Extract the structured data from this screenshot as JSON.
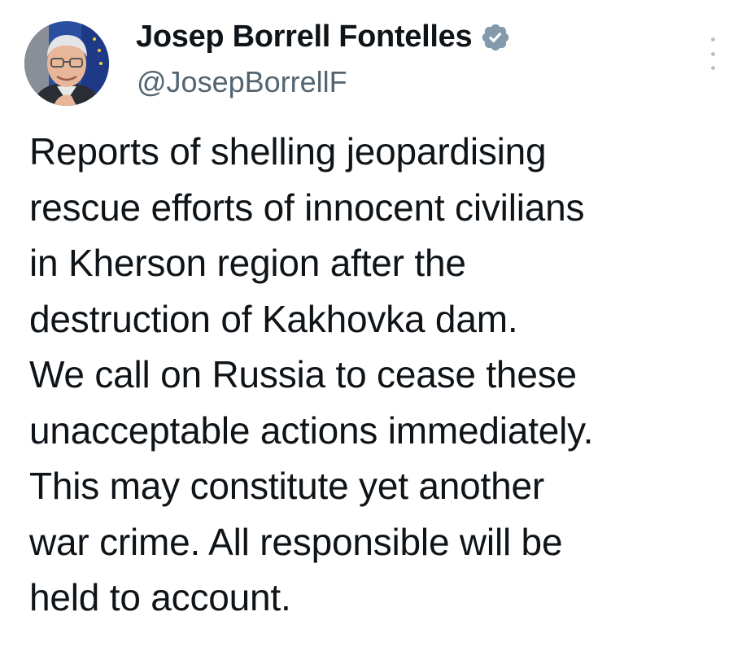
{
  "author": {
    "display_name": "Josep Borrell Fontelles",
    "handle": "@JosepBorrellF",
    "verified_badge_color": "#829aab",
    "avatar_icon": "profile-photo"
  },
  "tweet": {
    "lines": [
      "Reports of shelling jeopardising",
      "rescue efforts of innocent civilians",
      "in Kherson region after the",
      "destruction of Kakhovka dam.",
      "We call on Russia to cease these",
      "unacceptable actions immediately.",
      "This may constitute yet another",
      "war crime. All responsible will be",
      "held to account."
    ]
  },
  "menu": {
    "icon": "more-vertical-icon"
  }
}
